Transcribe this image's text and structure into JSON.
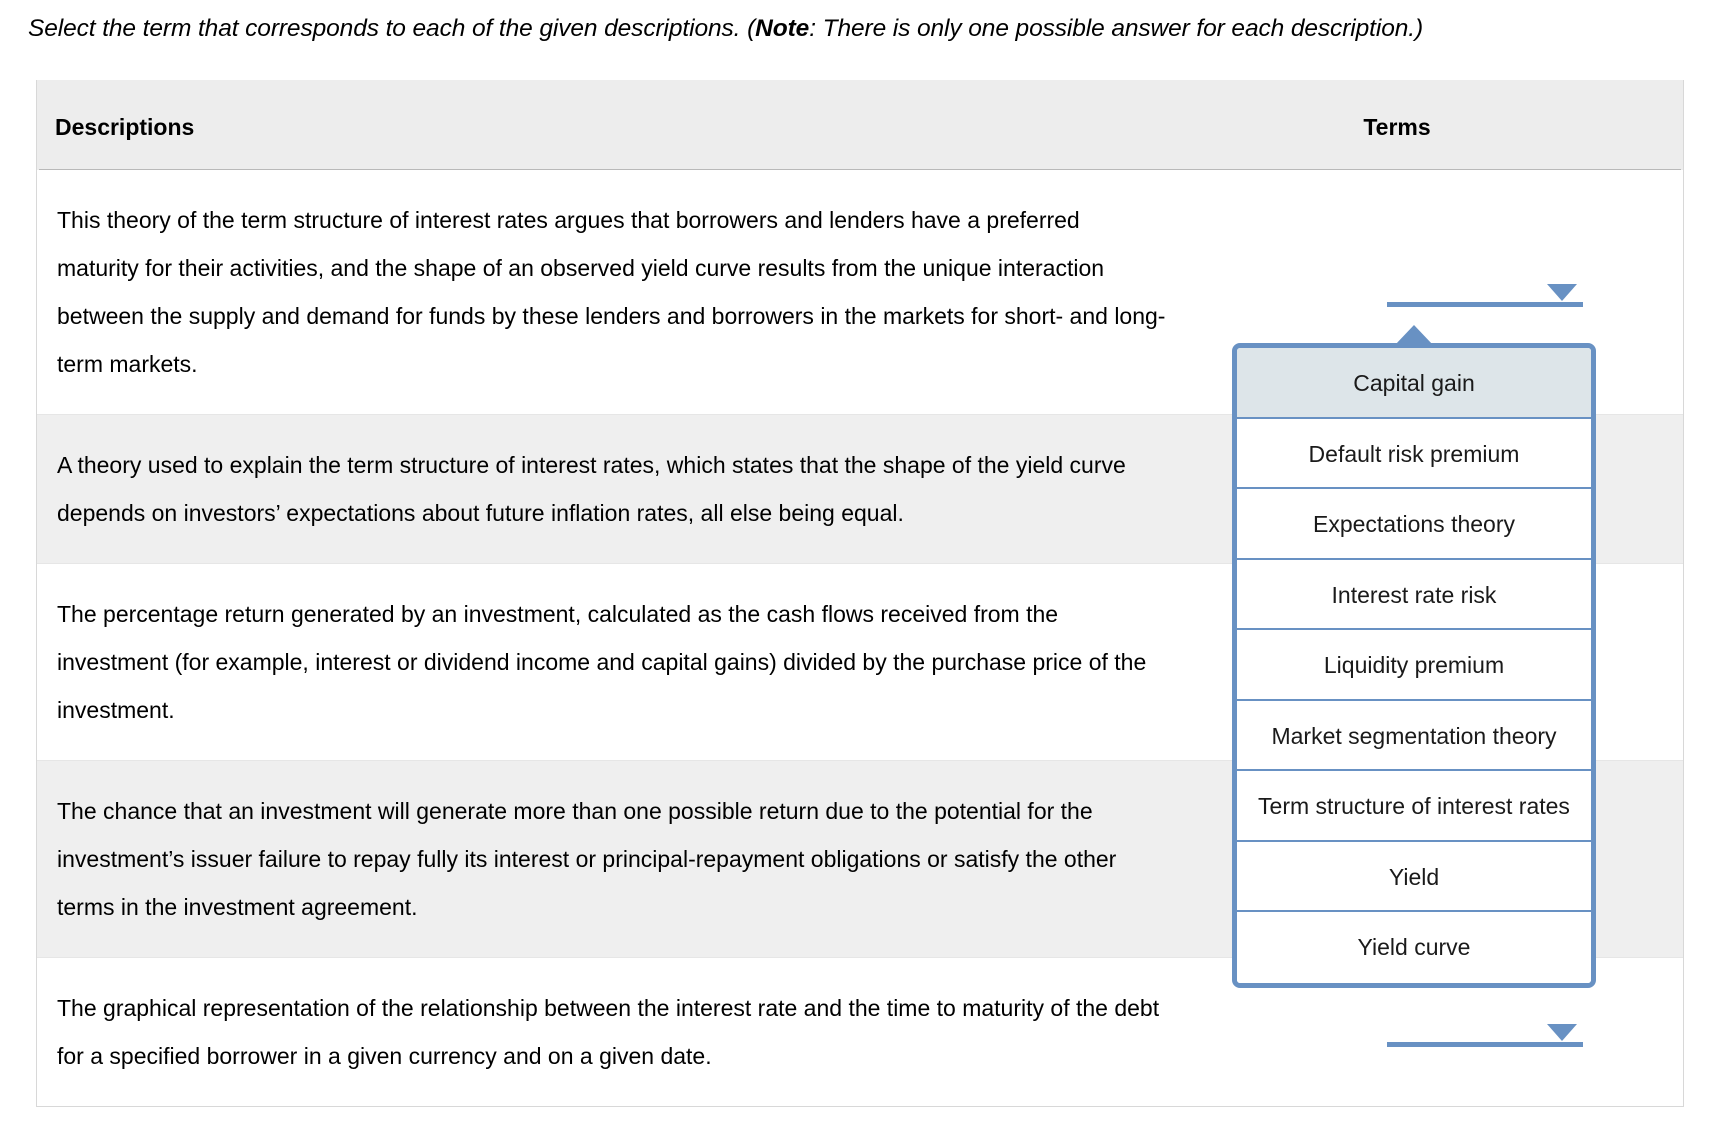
{
  "instruction": {
    "part1": "Select the term that corresponds to each of the given descriptions. (",
    "note_label": "Note",
    "part2": ": There is only one possible answer for each description.)"
  },
  "table": {
    "columns": {
      "descriptions": "Descriptions",
      "terms": "Terms"
    },
    "rows": [
      {
        "description": "This theory of the term structure of interest rates argues that borrowers and lenders have a preferred maturity for their activities, and the shape of an observed yield curve results from the unique interaction between the supply and demand for funds by these lenders and borrowers in the markets for short- and long-term markets.",
        "selected_term": "",
        "select_placeholder": ""
      },
      {
        "description": "A theory used to explain the term structure of interest rates, which states that the shape of the yield curve depends on investors’ expectations about future inflation rates, all else being equal.",
        "selected_term": "",
        "select_placeholder": ""
      },
      {
        "description": "The percentage return generated by an investment, calculated as the cash flows received from the investment (for example, interest or dividend income and capital gains) divided by the purchase price of the investment.",
        "selected_term": "",
        "select_placeholder": ""
      },
      {
        "description": "The chance that an investment will generate more than one possible return due to the potential for the investment’s issuer failure to repay fully its interest or principal-repayment obligations or satisfy the other terms in the investment agreement.",
        "selected_term": "",
        "select_placeholder": ""
      },
      {
        "description": "The graphical representation of the relationship between the interest rate and the time to maturity of the debt for a specified borrower in a given currency and on a given date.",
        "selected_term": "",
        "select_placeholder": ""
      }
    ]
  },
  "dropdown": {
    "open": true,
    "attached_to_row": 1,
    "highlighted_index": 0,
    "options": [
      "Capital gain",
      "Default risk premium",
      "Expectations theory",
      "Interest rate risk",
      "Liquidity premium",
      "Market segmentation theory",
      "Term structure of interest rates",
      "Yield",
      "Yield curve"
    ]
  },
  "icons": {
    "dropdown_arrow": "chevron-down-icon",
    "popup_pointer": "caret-up-icon"
  },
  "colors": {
    "accent_blue": "#6891c3",
    "header_gray": "#ededed",
    "row_alt_gray": "#efefef",
    "selected_option_bg": "#dde5e9",
    "text": "#000000"
  }
}
